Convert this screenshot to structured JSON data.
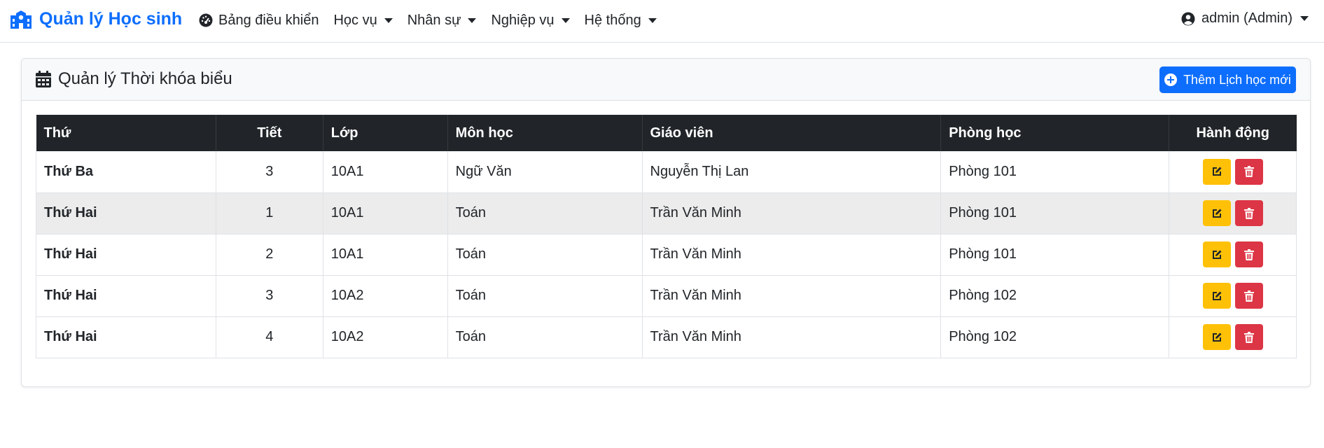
{
  "brand": {
    "title": "Quản lý Học sinh",
    "icon": "school-icon",
    "color": "#0d6efd"
  },
  "nav": {
    "dashboard": "Bảng điều khiển",
    "academics": "Học vụ",
    "staff": "Nhân sự",
    "operations": "Nghiệp vụ",
    "system": "Hệ thống"
  },
  "user": {
    "label": "admin (Admin)"
  },
  "card": {
    "title": "Quản lý Thời khóa biểu",
    "add_button": "Thêm Lịch học mới"
  },
  "table": {
    "headers": [
      "Thứ",
      "Tiết",
      "Lớp",
      "Môn học",
      "Giáo viên",
      "Phòng học",
      "Hành động"
    ],
    "rows": [
      {
        "day": "Thứ Ba",
        "period": "3",
        "class": "10A1",
        "subject": "Ngữ Văn",
        "teacher": "Nguyễn Thị Lan",
        "room": "Phòng 101"
      },
      {
        "day": "Thứ Hai",
        "period": "1",
        "class": "10A1",
        "subject": "Toán",
        "teacher": "Trần Văn Minh",
        "room": "Phòng 101"
      },
      {
        "day": "Thứ Hai",
        "period": "2",
        "class": "10A1",
        "subject": "Toán",
        "teacher": "Trần Văn Minh",
        "room": "Phòng 101"
      },
      {
        "day": "Thứ Hai",
        "period": "3",
        "class": "10A2",
        "subject": "Toán",
        "teacher": "Trần Văn Minh",
        "room": "Phòng 102"
      },
      {
        "day": "Thứ Hai",
        "period": "4",
        "class": "10A2",
        "subject": "Toán",
        "teacher": "Trần Văn Minh",
        "room": "Phòng 102"
      }
    ]
  },
  "colors": {
    "primary": "#0d6efd",
    "warning": "#ffc107",
    "danger": "#dc3545",
    "dark": "#212529"
  }
}
